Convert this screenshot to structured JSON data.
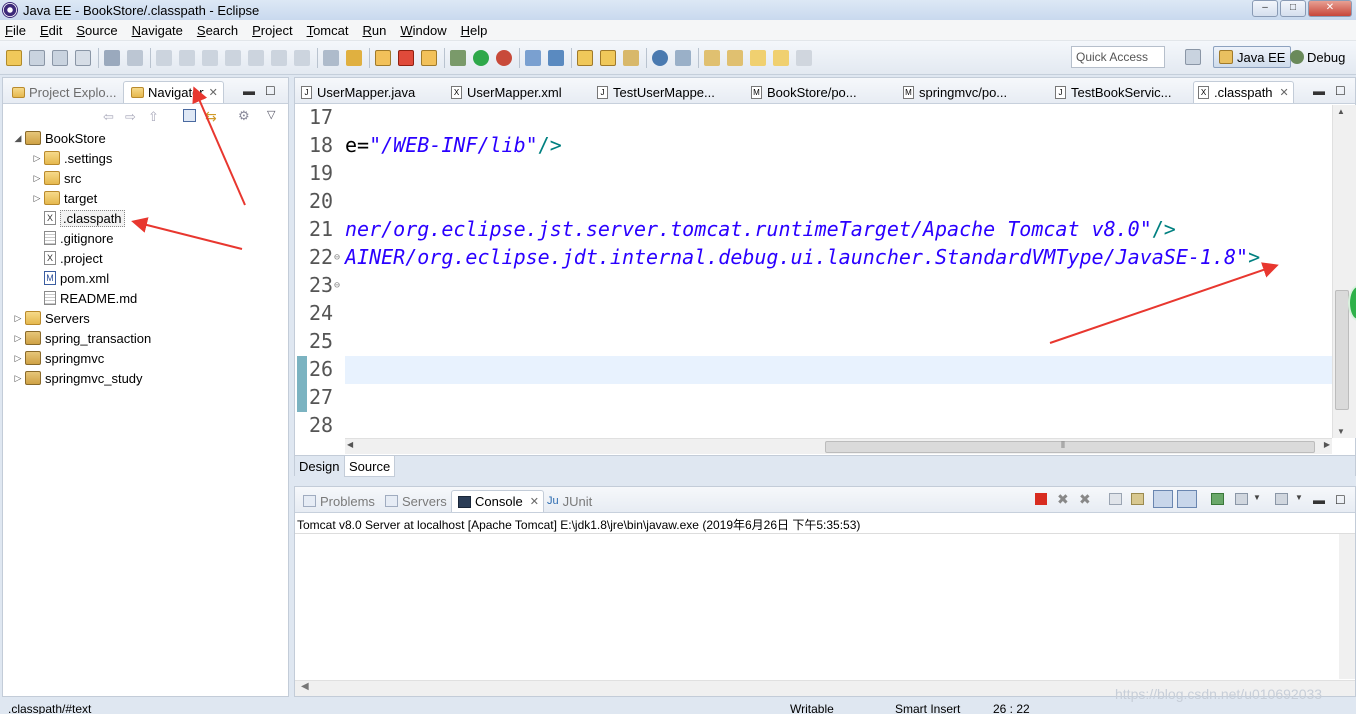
{
  "window": {
    "title": "Java EE - BookStore/.classpath - Eclipse",
    "min": "‒",
    "max": "□",
    "close": "✕"
  },
  "menu": [
    "File",
    "Edit",
    "Source",
    "Navigate",
    "Search",
    "Project",
    "Tomcat",
    "Run",
    "Window",
    "Help"
  ],
  "toolbar": {
    "quick_access": "Quick Access",
    "perspective_javaee": "Java EE",
    "perspective_debug": "Debug"
  },
  "left_panel": {
    "tabs": [
      {
        "label": "Project Explo...",
        "active": false
      },
      {
        "label": "Navigator",
        "active": true
      }
    ],
    "tree": [
      {
        "label": "BookStore",
        "indent": 0,
        "twisty": "◢",
        "icon": "project"
      },
      {
        "label": ".settings",
        "indent": 1,
        "twisty": "▷",
        "icon": "folder"
      },
      {
        "label": "src",
        "indent": 1,
        "twisty": "▷",
        "icon": "folder"
      },
      {
        "label": "target",
        "indent": 1,
        "twisty": "▷",
        "icon": "folder"
      },
      {
        "label": ".classpath",
        "indent": 1,
        "twisty": "",
        "icon": "xml",
        "selected": true
      },
      {
        "label": ".gitignore",
        "indent": 1,
        "twisty": "",
        "icon": "txt"
      },
      {
        "label": ".project",
        "indent": 1,
        "twisty": "",
        "icon": "xml"
      },
      {
        "label": "pom.xml",
        "indent": 1,
        "twisty": "",
        "icon": "pom"
      },
      {
        "label": "README.md",
        "indent": 1,
        "twisty": "",
        "icon": "txt"
      },
      {
        "label": "Servers",
        "indent": 0,
        "twisty": "▷",
        "icon": "folder"
      },
      {
        "label": "spring_transaction",
        "indent": 0,
        "twisty": "▷",
        "icon": "project"
      },
      {
        "label": "springmvc",
        "indent": 0,
        "twisty": "▷",
        "icon": "project"
      },
      {
        "label": "springmvc_study",
        "indent": 0,
        "twisty": "▷",
        "icon": "project"
      }
    ]
  },
  "editor": {
    "tabs": [
      {
        "label": "UserMapper.java",
        "icon": "J"
      },
      {
        "label": "UserMapper.xml",
        "icon": "X"
      },
      {
        "label": "TestUserMappe...",
        "icon": "J"
      },
      {
        "label": "BookStore/po...",
        "icon": "M"
      },
      {
        "label": "springmvc/po...",
        "icon": "M"
      },
      {
        "label": "TestBookServic...",
        "icon": "J"
      },
      {
        "label": ".classpath",
        "icon": "X",
        "active": true
      }
    ],
    "lines": [
      {
        "num": "17",
        "value": "",
        "tail": ""
      },
      {
        "num": "18",
        "eq": "e=",
        "value": "\"/WEB-INF/lib\"",
        "tail": "/>"
      },
      {
        "num": "19",
        "value": "",
        "tail": ""
      },
      {
        "num": "20",
        "value": "",
        "tail": ""
      },
      {
        "num": "21",
        "value": "ner/org.eclipse.jst.server.tomcat.runtimeTarget/Apache Tomcat v8.0\"",
        "tail": "/>"
      },
      {
        "num": "22",
        "value": "AINER/org.eclipse.jdt.internal.debug.ui.launcher.StandardVMType/JavaSE-1.8\"",
        "tail": ">",
        "fold": "⊖"
      },
      {
        "num": "23",
        "value": "",
        "tail": "",
        "fold": "⊖"
      },
      {
        "num": "24",
        "value": "",
        "tail": ""
      },
      {
        "num": "25",
        "value": "",
        "tail": ""
      },
      {
        "num": "26",
        "value": "",
        "tail": ""
      },
      {
        "num": "27",
        "value": "",
        "tail": ""
      },
      {
        "num": "28",
        "value": "",
        "tail": ""
      }
    ],
    "bottom_tabs": [
      "Design",
      "Source"
    ],
    "scroll_grip": "⦀"
  },
  "console": {
    "tabs": [
      {
        "label": "Problems",
        "active": false
      },
      {
        "label": "Servers",
        "active": false
      },
      {
        "label": "Console",
        "active": true
      },
      {
        "label": "JUnit",
        "active": false
      }
    ],
    "label": "Tomcat v8.0 Server at localhost [Apache Tomcat] E:\\jdk1.8\\jre\\bin\\javaw.exe (2019年6月26日 下午5:35:53)"
  },
  "status": {
    "path": ".classpath/#text",
    "writable": "Writable",
    "insert_mode": "Smart Insert",
    "position": "26 : 22"
  },
  "watermark": "https://blog.csdn.net/u010692033",
  "colors": {
    "annotation_arrow": "#e8372f",
    "xml_value": "#2a00ff",
    "xml_tag": "#008080"
  }
}
